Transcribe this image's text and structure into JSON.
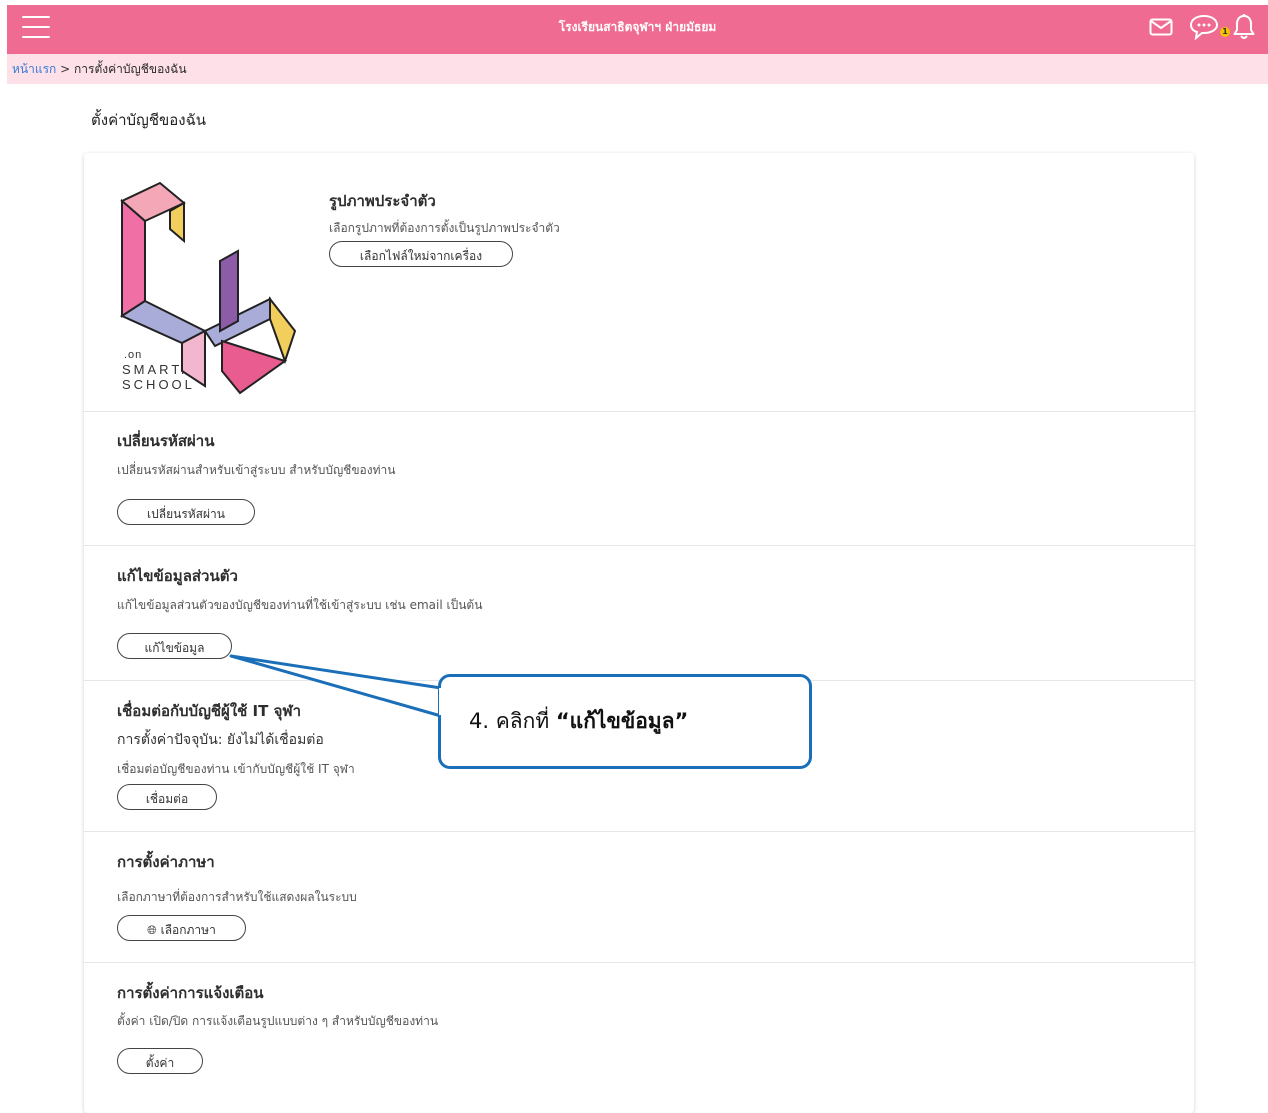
{
  "header": {
    "school_name": "โรงเรียนสาธิตจุฬาฯ ฝ่ายมัธยม",
    "badge_count": "1",
    "icons": [
      "menu-icon",
      "mail-icon",
      "chat-icon",
      "bell-icon"
    ]
  },
  "breadcrumb": {
    "home": "หน้าแรก",
    "separator": ">",
    "current": "การตั้งค่าบัญชีของฉัน"
  },
  "page_title": "ตั้งค่าบัญชีของฉัน",
  "logo": {
    "small": ".on",
    "line1": "SMART.",
    "line2": "SCHOOL"
  },
  "profile": {
    "title": "รูปภาพประจำตัว",
    "desc": "เลือกรูปภาพที่ต้องการตั้งเป็นรูปภาพประจำตัว",
    "button": "เลือกไฟล์ใหม่จากเครื่อง"
  },
  "password": {
    "title": "เปลี่ยนรหัสผ่าน",
    "desc": "เปลี่ยนรหัสผ่านสำหรับเข้าสู่ระบบ สำหรับบัญชีของท่าน",
    "button": "เปลี่ยนรหัสผ่าน"
  },
  "personal": {
    "title": "แก้ไขข้อมูลส่วนตัว",
    "desc": "แก้ไขข้อมูลส่วนตัวของบัญชีของท่านที่ใช้เข้าสู่ระบบ เช่น email เป็นต้น",
    "button": "แก้ไขข้อมูล"
  },
  "it_account": {
    "title": "เชื่อมต่อกับบัญชีผู้ใช้ IT จุฬา",
    "status": "การตั้งค่าปัจจุบัน: ยังไม่ได้เชื่อมต่อ",
    "desc": "เชื่อมต่อบัญชีของท่าน เข้ากับบัญชีผู้ใช้ IT จุฬา",
    "button": "เชื่อมต่อ"
  },
  "language": {
    "title": "การตั้งค่าภาษา",
    "desc": "เลือกภาษาที่ต้องการสำหรับใช้แสดงผลในระบบ",
    "button": "เลือกภาษา"
  },
  "notification": {
    "title": "การตั้งค่าการแจ้งเตือน",
    "desc": "ตั้งค่า เปิด/ปิด การแจ้งเตือนรูปแบบต่าง ๆ สำหรับบัญชีของท่าน",
    "button": "ตั้งค่า"
  },
  "callout": {
    "prefix": "4. คลิกที่ ",
    "highlight": "“แก้ไขข้อมูล”",
    "border_color": "#1a6fb8"
  },
  "colors": {
    "header": "#f06b92",
    "breadcrumb_bg": "#fde0e8",
    "link": "#3a7bd5"
  }
}
